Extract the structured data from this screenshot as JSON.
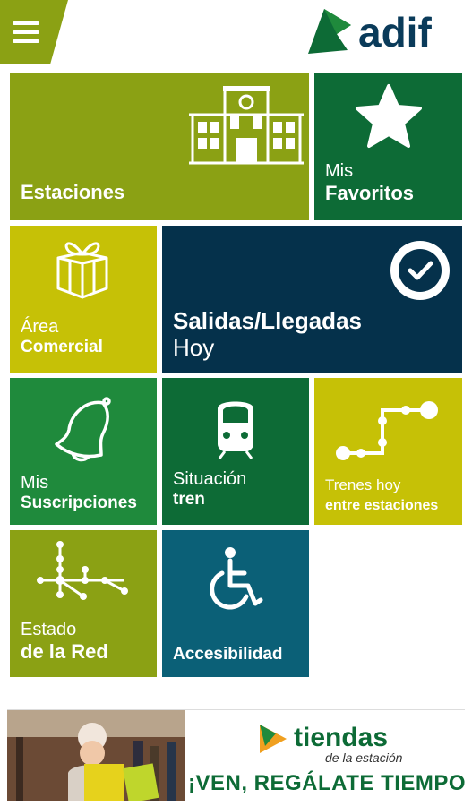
{
  "header": {
    "menu_icon": "hamburger-icon",
    "logo_text": "adif"
  },
  "tiles": {
    "estaciones": {
      "line1": "Estaciones",
      "icon": "station-building-icon"
    },
    "favoritos": {
      "line1": "Mis",
      "line2": "Favoritos",
      "icon": "star-icon"
    },
    "comercial": {
      "line1": "Área",
      "line2": "Comercial",
      "icon": "gift-icon"
    },
    "salidas": {
      "line1": "Salidas/Llegadas",
      "line2": "Hoy",
      "icon": "clock-check-icon"
    },
    "suscripciones": {
      "line1": "Mis",
      "line2": "Suscripciones",
      "icon": "bell-icon"
    },
    "situacion": {
      "line1": "Situación",
      "line2": "tren",
      "icon": "train-icon"
    },
    "trenes": {
      "line1": "Trenes hoy",
      "line2": "entre estaciones",
      "icon": "route-icon"
    },
    "red": {
      "line1": "Estado",
      "line2": "de la Red",
      "icon": "network-icon"
    },
    "accesibilidad": {
      "line1": "Accesibilidad",
      "icon": "wheelchair-icon"
    }
  },
  "banner": {
    "brand": "tiendas",
    "brand_sub": "de la estación",
    "slogan": "¡VEN, REGÁLATE TIEMPO!"
  },
  "colors": {
    "light_green": "#8ba114",
    "yellow_green": "#c6c106",
    "dark_green": "#0d6b36",
    "mid_green": "#1f8a3c",
    "navy": "#05314b",
    "teal": "#0b6077"
  }
}
